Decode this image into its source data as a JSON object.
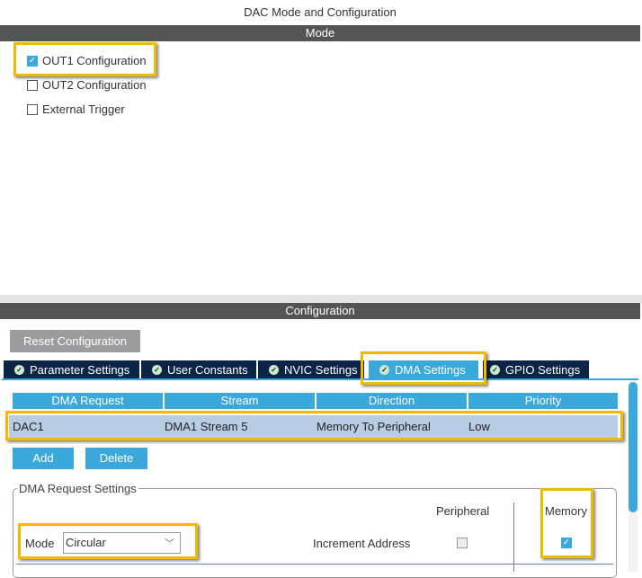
{
  "title": "DAC Mode and Configuration",
  "mode": {
    "header": "Mode",
    "options": [
      {
        "label": "OUT1 Configuration",
        "checked": true
      },
      {
        "label": "OUT2 Configuration",
        "checked": false
      },
      {
        "label": "External Trigger",
        "checked": false
      }
    ]
  },
  "config": {
    "header": "Configuration",
    "reset_label": "Reset Configuration",
    "tabs": [
      {
        "label": "Parameter Settings"
      },
      {
        "label": "User Constants"
      },
      {
        "label": "NVIC Settings"
      },
      {
        "label": "DMA Settings",
        "active": true
      },
      {
        "label": "GPIO Settings"
      }
    ],
    "table": {
      "columns": [
        "DMA Request",
        "Stream",
        "Direction",
        "Priority"
      ],
      "rows": [
        [
          "DAC1",
          "DMA1 Stream 5",
          "Memory To Peripheral",
          "Low"
        ]
      ]
    },
    "add_label": "Add",
    "delete_label": "Delete",
    "request_settings": {
      "legend": "DMA Request Settings",
      "mode_label": "Mode",
      "mode_value": "Circular",
      "peripheral_label": "Peripheral",
      "memory_label": "Memory",
      "increment_label": "Increment Address",
      "peripheral_checked": false,
      "memory_checked": true
    }
  },
  "colors": {
    "accent": "#3ba8dc",
    "tab_bg": "#0b2447",
    "highlight": "#f5b800",
    "bar": "#535554"
  }
}
